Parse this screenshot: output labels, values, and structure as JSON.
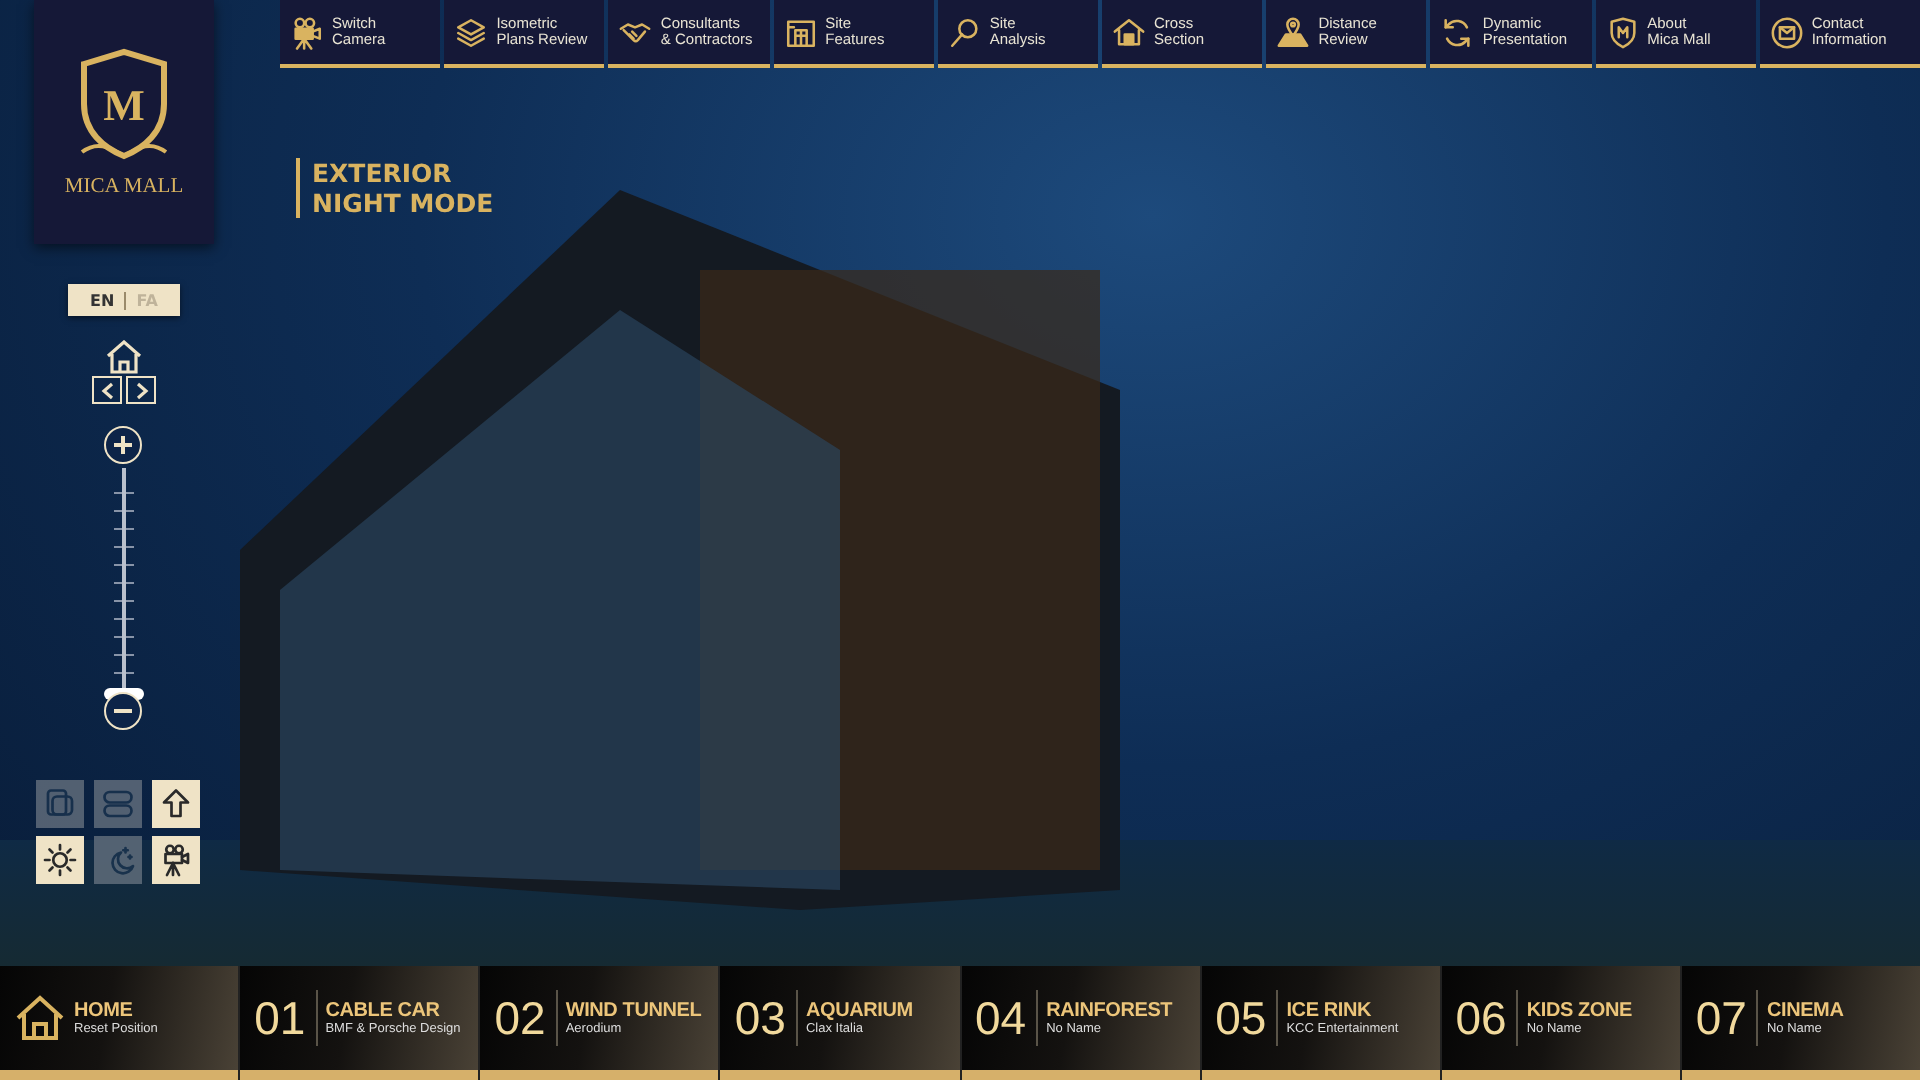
{
  "logo": {
    "letter": "M",
    "name": "MICA MALL"
  },
  "nav": [
    {
      "label": "Switch\nCamera"
    },
    {
      "label": "Isometric\nPlans Review"
    },
    {
      "label": "Consultants\n& Contractors"
    },
    {
      "label": "Site\nFeatures"
    },
    {
      "label": "Site\nAnalysis"
    },
    {
      "label": "Cross\nSection"
    },
    {
      "label": "Distance\nReview"
    },
    {
      "label": "Dynamic\nPresentation"
    },
    {
      "label": "About\nMica Mall"
    },
    {
      "label": "Contact\nInformation"
    }
  ],
  "mode_title": "EXTERIOR\nNIGHT MODE",
  "languages": [
    {
      "label": "EN",
      "selected": true
    },
    {
      "label": "FA",
      "selected": false
    }
  ],
  "zoom": {
    "level": 0
  },
  "tools": [
    {
      "enabled": false
    },
    {
      "enabled": false
    },
    {
      "enabled": true
    },
    {
      "enabled": true
    },
    {
      "enabled": false
    },
    {
      "enabled": true
    }
  ],
  "tour": [
    {
      "kind": "home",
      "title": "HOME",
      "subtitle": "Reset Position"
    },
    {
      "kind": "stop",
      "number": "01",
      "title": "CABLE CAR",
      "subtitle": "BMF & Porsche Design"
    },
    {
      "kind": "stop",
      "number": "02",
      "title": "WIND TUNNEL",
      "subtitle": "Aerodium"
    },
    {
      "kind": "stop",
      "number": "03",
      "title": "AQUARIUM",
      "subtitle": "Clax Italia"
    },
    {
      "kind": "stop",
      "number": "04",
      "title": "RAINFOREST",
      "subtitle": "No Name"
    },
    {
      "kind": "stop",
      "number": "05",
      "title": "ICE RINK",
      "subtitle": "KCC Entertainment"
    },
    {
      "kind": "stop",
      "number": "06",
      "title": "KIDS ZONE",
      "subtitle": "No Name"
    },
    {
      "kind": "stop",
      "number": "07",
      "title": "CINEMA",
      "subtitle": "No Name"
    }
  ]
}
